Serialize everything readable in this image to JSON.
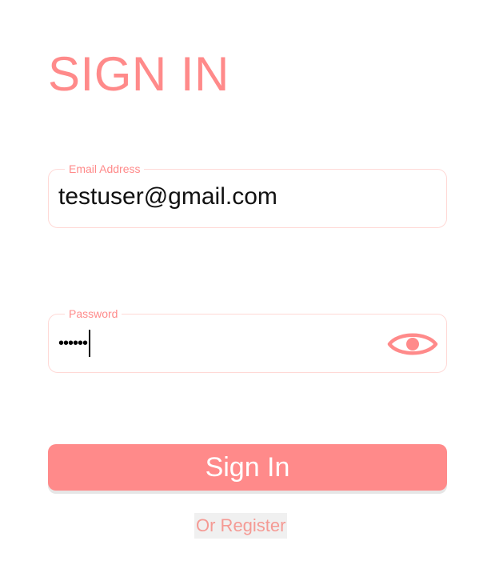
{
  "header": {
    "title": "SIGN IN"
  },
  "form": {
    "email": {
      "label": "Email Address",
      "value": "testuser@gmail.com"
    },
    "password": {
      "label": "Password",
      "masked_value": "••••••",
      "toggle_icon": "eye-icon"
    },
    "submit_label": "Sign In",
    "register_link": "Or Register"
  },
  "colors": {
    "accent": "#ff8a8a",
    "field_border": "#ffd9d6",
    "register_text": "#f59a94",
    "register_bg": "#f0f0f0"
  }
}
